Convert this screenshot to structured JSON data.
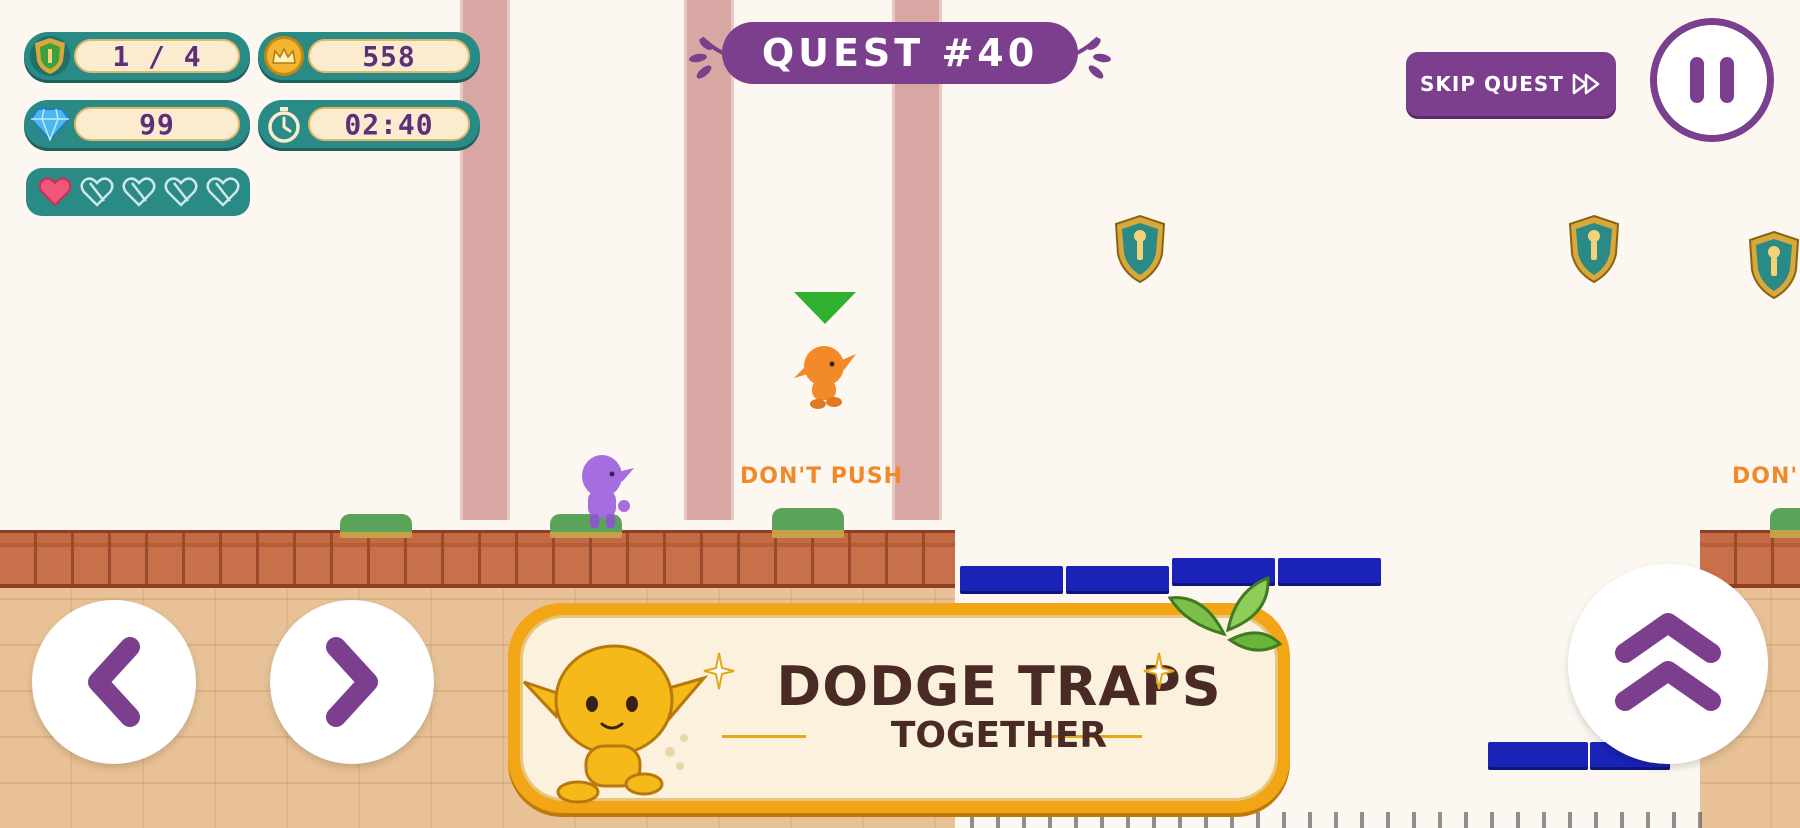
{
  "hud": {
    "shields": {
      "value": "1 / 4",
      "icon": "shield-icon"
    },
    "coins": {
      "value": "558",
      "icon": "crown-coin-icon"
    },
    "gems": {
      "value": "99",
      "icon": "diamond-icon"
    },
    "timer": {
      "value": "02:40",
      "icon": "stopwatch-icon"
    },
    "lives": {
      "filled": 1,
      "total": 5
    }
  },
  "quest": {
    "title": "QUEST #40"
  },
  "controls": {
    "skip_label": "SKIP QUEST",
    "pause": "pause-icon",
    "left": "chevron-left-icon",
    "right": "chevron-right-icon",
    "jump": "double-chevron-up-icon"
  },
  "world": {
    "warning_1": "DON'T PUSH",
    "warning_2": "DON'"
  },
  "tutorial": {
    "line1": "DODGE TRAPS",
    "line2": "TOGETHER"
  },
  "colors": {
    "purple": "#7b3f8e",
    "teal": "#2a8a86",
    "blue_block": "#1a22b8",
    "orange_text": "#f0892a",
    "banner_gold": "#f2a616"
  }
}
